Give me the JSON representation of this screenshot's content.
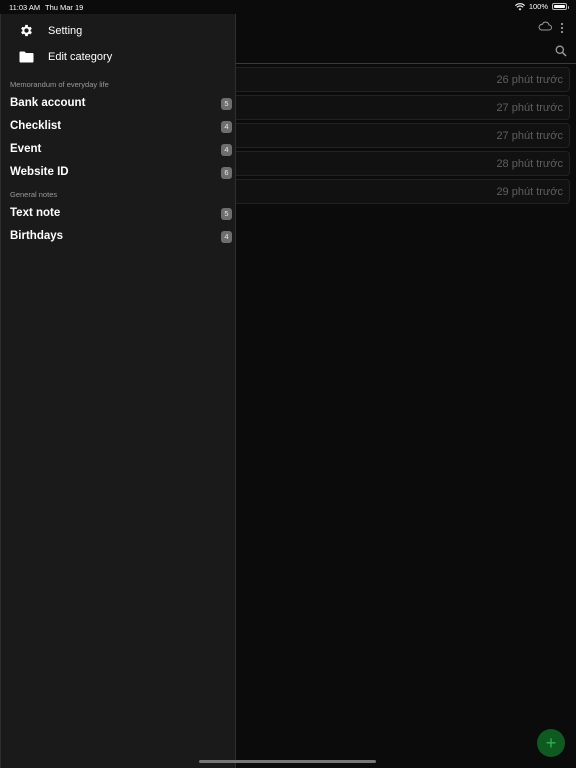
{
  "status_bar": {
    "time": "11:03 AM",
    "date": "Thu Mar 19",
    "battery": "100%"
  },
  "drawer": {
    "menu": [
      {
        "label": "Setting",
        "icon": "gear-icon"
      },
      {
        "label": "Edit category",
        "icon": "folder-icon"
      }
    ],
    "sections": [
      {
        "title": "Memorandum of everyday life",
        "items": [
          {
            "label": "Bank account",
            "count": "5"
          },
          {
            "label": "Checklist",
            "count": "4"
          },
          {
            "label": "Event",
            "count": "4"
          },
          {
            "label": "Website ID",
            "count": "6"
          }
        ]
      },
      {
        "title": "General notes",
        "items": [
          {
            "label": "Text note",
            "count": "5"
          },
          {
            "label": "Birthdays",
            "count": "4"
          }
        ]
      }
    ]
  },
  "main": {
    "notes": [
      {
        "time_ago": "26 phút trước"
      },
      {
        "time_ago": "27 phút trước"
      },
      {
        "time_ago": "27 phút trước"
      },
      {
        "time_ago": "28 phút trước"
      },
      {
        "time_ago": "29 phút trước"
      }
    ],
    "fab_label": "+"
  },
  "colors": {
    "background": "#0b0b0b",
    "drawer": "#1a1a1a",
    "badge": "#6e6e6e",
    "fab": "#0f5a20",
    "fab_icon": "#34b254"
  }
}
